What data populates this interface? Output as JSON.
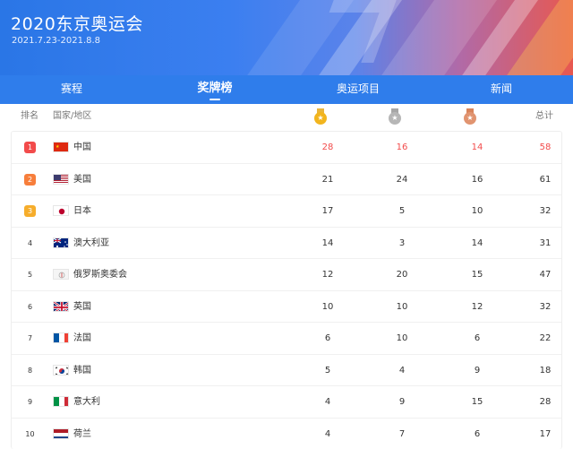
{
  "header": {
    "title": "2020东京奥运会",
    "dates": "2021.7.23-2021.8.8"
  },
  "tabs": [
    {
      "label": "赛程",
      "active": false
    },
    {
      "label": "奖牌榜",
      "active": true
    },
    {
      "label": "奥运项目",
      "active": false
    },
    {
      "label": "新闻",
      "active": false
    }
  ],
  "columns": {
    "rank": "排名",
    "country": "国家/地区",
    "gold_icon": "gold-medal-icon",
    "silver_icon": "silver-medal-icon",
    "bronze_icon": "bronze-medal-icon",
    "total": "总计"
  },
  "colors": {
    "accent": "#2f7deb",
    "highlight": "#f24b4b"
  },
  "rows": [
    {
      "rank": "1",
      "country": "中国",
      "flag": "china-flag-icon",
      "gold": "28",
      "silver": "16",
      "bronze": "14",
      "total": "58"
    },
    {
      "rank": "2",
      "country": "美国",
      "flag": "usa-flag-icon",
      "gold": "21",
      "silver": "24",
      "bronze": "16",
      "total": "61"
    },
    {
      "rank": "3",
      "country": "日本",
      "flag": "japan-flag-icon",
      "gold": "17",
      "silver": "5",
      "bronze": "10",
      "total": "32"
    },
    {
      "rank": "4",
      "country": "澳大利亚",
      "flag": "australia-flag-icon",
      "gold": "14",
      "silver": "3",
      "bronze": "14",
      "total": "31"
    },
    {
      "rank": "5",
      "country": "俄罗斯奥委会",
      "flag": "roc-flag-icon",
      "gold": "12",
      "silver": "20",
      "bronze": "15",
      "total": "47"
    },
    {
      "rank": "6",
      "country": "英国",
      "flag": "uk-flag-icon",
      "gold": "10",
      "silver": "10",
      "bronze": "12",
      "total": "32"
    },
    {
      "rank": "7",
      "country": "法国",
      "flag": "france-flag-icon",
      "gold": "6",
      "silver": "10",
      "bronze": "6",
      "total": "22"
    },
    {
      "rank": "8",
      "country": "韩国",
      "flag": "korea-flag-icon",
      "gold": "5",
      "silver": "4",
      "bronze": "9",
      "total": "18"
    },
    {
      "rank": "9",
      "country": "意大利",
      "flag": "italy-flag-icon",
      "gold": "4",
      "silver": "9",
      "bronze": "15",
      "total": "28"
    },
    {
      "rank": "10",
      "country": "荷兰",
      "flag": "netherlands-flag-icon",
      "gold": "4",
      "silver": "7",
      "bronze": "6",
      "total": "17"
    }
  ]
}
